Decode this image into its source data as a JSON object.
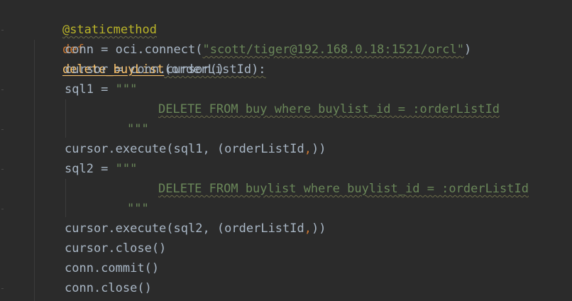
{
  "code": {
    "decorator": "@staticmethod",
    "def_kw": "def",
    "func_name": "delete_buyList",
    "param": "(orderListId):",
    "conn_assign": "conn = oci.connect(",
    "conn_str": "\"scott/tiger@192.168.0.18:1521/orcl\"",
    "close_paren": ")",
    "cursor_line": "cursor = conn.cursor()",
    "sql1_assign": "sql1 = ",
    "triple_open": "\"\"\"",
    "sql1_body": "DELETE FROM buy where buylist_id = :orderListId",
    "triple_close": "\"\"\"",
    "exec1_pre": "cursor.execute(sql1, (orderListId",
    "comma": ",",
    "exec_post": "))",
    "sql2_assign": "sql2 = ",
    "sql2_body": "DELETE FROM buylist where buylist_id = :orderListId",
    "exec2_pre": "cursor.execute(sql2, (orderListId",
    "cursor_close": "cursor.close()",
    "conn_commit": "conn.commit()",
    "conn_close": "conn.close()"
  }
}
